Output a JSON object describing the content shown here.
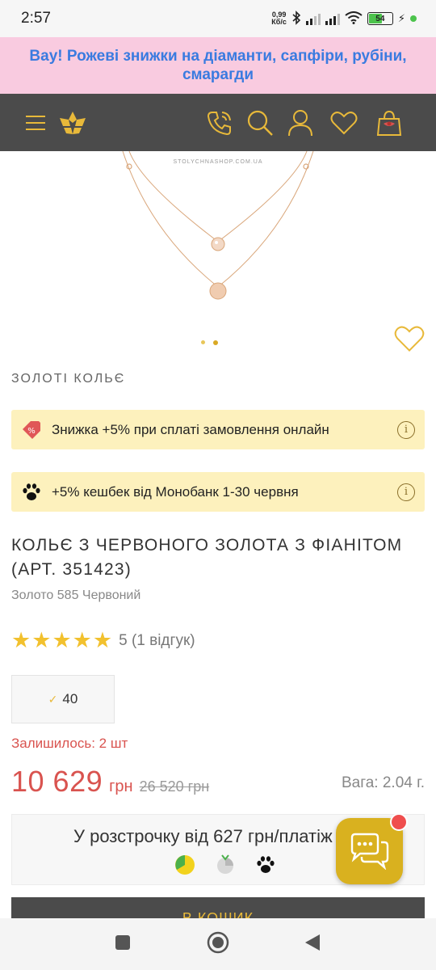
{
  "status": {
    "time": "2:57",
    "net_speed_top": "0,99",
    "net_speed_bottom": "Кб/с",
    "battery": "54"
  },
  "promo": {
    "text": "Вау! Рожеві знижки на діаманти, сапфіри, рубіни, смарагди"
  },
  "header": {
    "icons": [
      "menu-icon",
      "logo-icon",
      "phone-icon",
      "search-icon",
      "user-icon",
      "heart-icon",
      "cart-icon"
    ]
  },
  "gallery": {
    "watermark": "STOLYCHNASHOP.COM.UA",
    "slides": 2,
    "active_slide": 2
  },
  "category": "ЗОЛОТІ КОЛЬЄ",
  "offers": [
    {
      "icon": "discount-tag-icon",
      "text": "Знижка +5% при сплаті замовлення онлайн"
    },
    {
      "icon": "paw-icon",
      "text": "+5% кешбек від Монобанк 1-30 червня"
    }
  ],
  "product": {
    "title": "КОЛЬЄ З ЧЕРВОНОГО ЗОЛОТА З ФІАНІТОМ (АРТ. 351423)",
    "subtitle": "Золото 585 Червоний",
    "rating_stars": 5,
    "rating_text": "5 (1 відгук)",
    "size": "40",
    "stock": "Залишилось: 2 шт",
    "price": "10 629",
    "currency": "грн",
    "old_price": "26 520 грн",
    "weight": "Вага: 2.04 г."
  },
  "installment": {
    "text": "У розстрочку від 627 грн/платіж",
    "banks": [
      "privat-icon",
      "abank-icon",
      "monobank-paw-icon"
    ]
  },
  "buy_button": {
    "label": "В КОШИК"
  },
  "colors": {
    "header_bg": "#4b4b4b",
    "promo_bg": "#f9cbe0",
    "promo_text": "#3a7be0",
    "gold": "#e8b93a",
    "price_red": "#d9534f",
    "offer_bg": "#fdf1bd"
  }
}
